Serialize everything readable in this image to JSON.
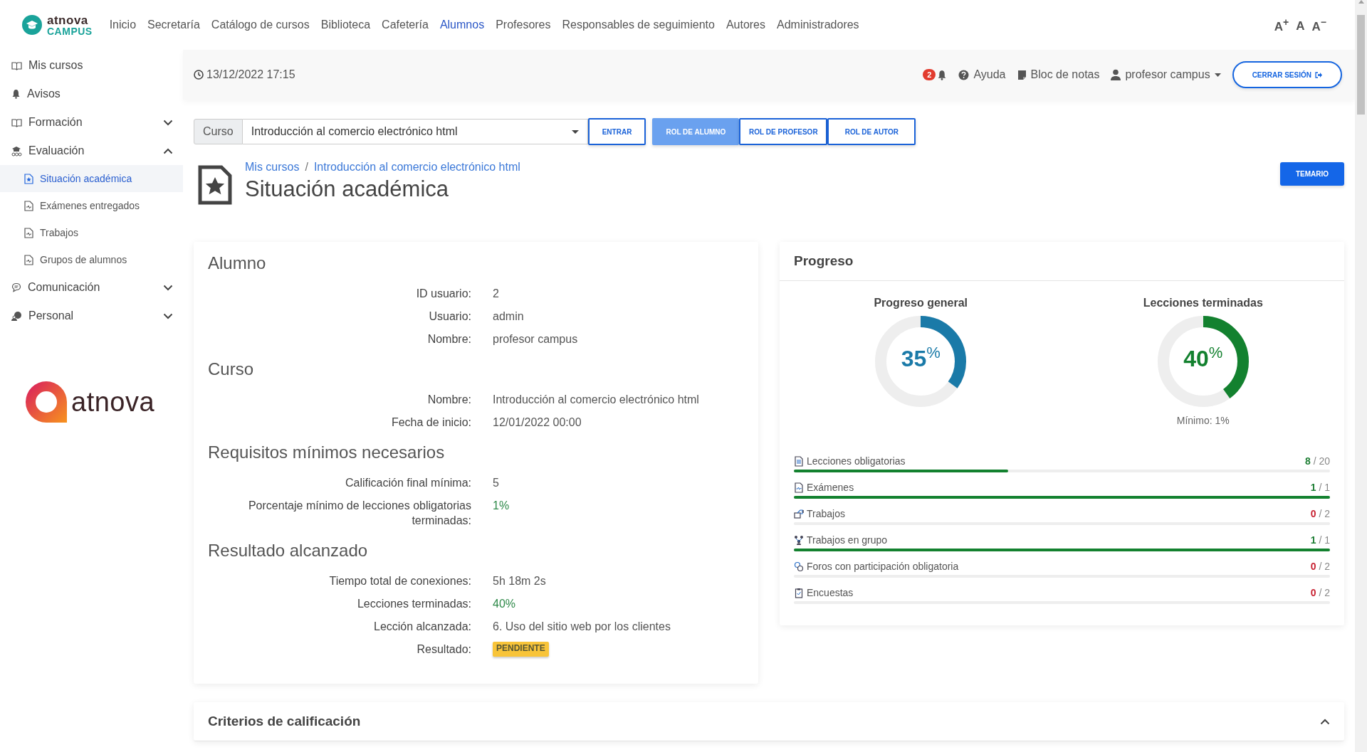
{
  "brand": {
    "name": "atnova",
    "product": "CAMPUS"
  },
  "nav": [
    {
      "label": "Inicio",
      "selected": false
    },
    {
      "label": "Secretaría",
      "selected": false
    },
    {
      "label": "Catálogo de cursos",
      "selected": false
    },
    {
      "label": "Biblioteca",
      "selected": false
    },
    {
      "label": "Cafetería",
      "selected": false
    },
    {
      "label": "Alumnos",
      "selected": true
    },
    {
      "label": "Profesores",
      "selected": false
    },
    {
      "label": "Responsables de seguimiento",
      "selected": false
    },
    {
      "label": "Autores",
      "selected": false
    },
    {
      "label": "Administradores",
      "selected": false
    }
  ],
  "font_size_controls": [
    {
      "letter": "A",
      "sign": "+"
    },
    {
      "letter": "A"
    },
    {
      "letter": "A",
      "sign": "−"
    }
  ],
  "sidebar": {
    "items": [
      {
        "label": "Mis cursos"
      },
      {
        "label": "Avisos"
      },
      {
        "label": "Formación",
        "expanded": false
      },
      {
        "label": "Evaluación",
        "expanded": true,
        "children": [
          {
            "label": "Situación académica",
            "selected": true
          },
          {
            "label": "Exámenes entregados",
            "selected": false
          },
          {
            "label": "Trabajos",
            "selected": false
          },
          {
            "label": "Grupos de alumnos",
            "selected": false
          }
        ]
      },
      {
        "label": "Comunicación",
        "expanded": false
      },
      {
        "label": "Personal",
        "expanded": false
      }
    ],
    "logo": "atnova"
  },
  "header": {
    "datetime": "13/12/2022 17:15",
    "notifications": "2",
    "help": "Ayuda",
    "notes": "Bloc de notas",
    "user": "profesor campus",
    "logout": "CERRAR SESIÓN"
  },
  "course_bar": {
    "label": "Curso",
    "value": "Introducción al comercio electrónico html",
    "enter": "ENTRAR",
    "roles": [
      {
        "label": "ROL DE ALUMNO",
        "selected": true
      },
      {
        "label": "ROL DE PROFESOR",
        "selected": false
      },
      {
        "label": "ROL DE AUTOR",
        "selected": false
      }
    ]
  },
  "breadcrumb": {
    "links": [
      "Mis cursos",
      "Introducción al comercio electrónico html"
    ],
    "separator": "/"
  },
  "title": "Situación académica",
  "syllabus_button": "TEMARIO",
  "details": [
    {
      "heading": "Alumno",
      "fields": [
        {
          "label": "ID usuario:",
          "value": "2",
          "kind": "text"
        },
        {
          "label": "Usuario:",
          "value": "admin",
          "kind": "text"
        },
        {
          "label": "Nombre:",
          "value": "profesor campus",
          "kind": "text"
        }
      ]
    },
    {
      "heading": "Curso",
      "fields": [
        {
          "label": "Nombre:",
          "value": "Introducción al comercio electrónico html",
          "kind": "text"
        },
        {
          "label": "Fecha de inicio:",
          "value": "12/01/2022 00:00",
          "kind": "text"
        }
      ]
    },
    {
      "heading": "Requisitos mínimos necesarios",
      "fields": [
        {
          "label": "Calificación final mínima:",
          "value": "5",
          "kind": "text"
        },
        {
          "label": "Porcentaje mínimo de lecciones obligatorias terminadas:",
          "value": "1%",
          "kind": "success"
        }
      ]
    },
    {
      "heading": "Resultado alcanzado",
      "fields": [
        {
          "label": "Tiempo total de conexiones:",
          "value": "5h 18m 2s",
          "kind": "text"
        },
        {
          "label": "Lecciones terminadas:",
          "value": "40%",
          "kind": "success"
        },
        {
          "label": "Lección alcanzada:",
          "value": "6. Uso del sitio web por los clientes",
          "kind": "text"
        },
        {
          "label": "Resultado:",
          "value": "PENDIENTE",
          "kind": "badge"
        }
      ]
    }
  ],
  "progress": {
    "title": "Progreso",
    "gauges": [
      {
        "title": "Progreso general",
        "value": "35",
        "unit": "%",
        "level": 0.35,
        "color": "#1a7aa8"
      },
      {
        "title": "Lecciones terminadas",
        "value": "40",
        "unit": "%",
        "level": 0.4,
        "color": "#13812f",
        "note": "Mínimo: 1%"
      }
    ],
    "rows": [
      {
        "label": "Lecciones obligatorias",
        "done": "8",
        "separator": "/",
        "total": "20",
        "met": true,
        "level": 0.4
      },
      {
        "label": "Exámenes",
        "done": "1",
        "separator": "/",
        "total": "1",
        "met": true,
        "level": 1
      },
      {
        "label": "Trabajos",
        "done": "0",
        "separator": "/",
        "total": "2",
        "met": false,
        "level": 0
      },
      {
        "label": "Trabajos en grupo",
        "done": "1",
        "separator": "/",
        "total": "1",
        "met": true,
        "level": 1
      },
      {
        "label": "Foros con participación obligatoria",
        "done": "0",
        "separator": "/",
        "total": "2",
        "met": false,
        "level": 0
      },
      {
        "label": "Encuestas",
        "done": "0",
        "separator": "/",
        "total": "2",
        "met": false,
        "level": 0
      }
    ]
  },
  "criteria": {
    "title": "Criterios de calificación",
    "expanded": true
  }
}
